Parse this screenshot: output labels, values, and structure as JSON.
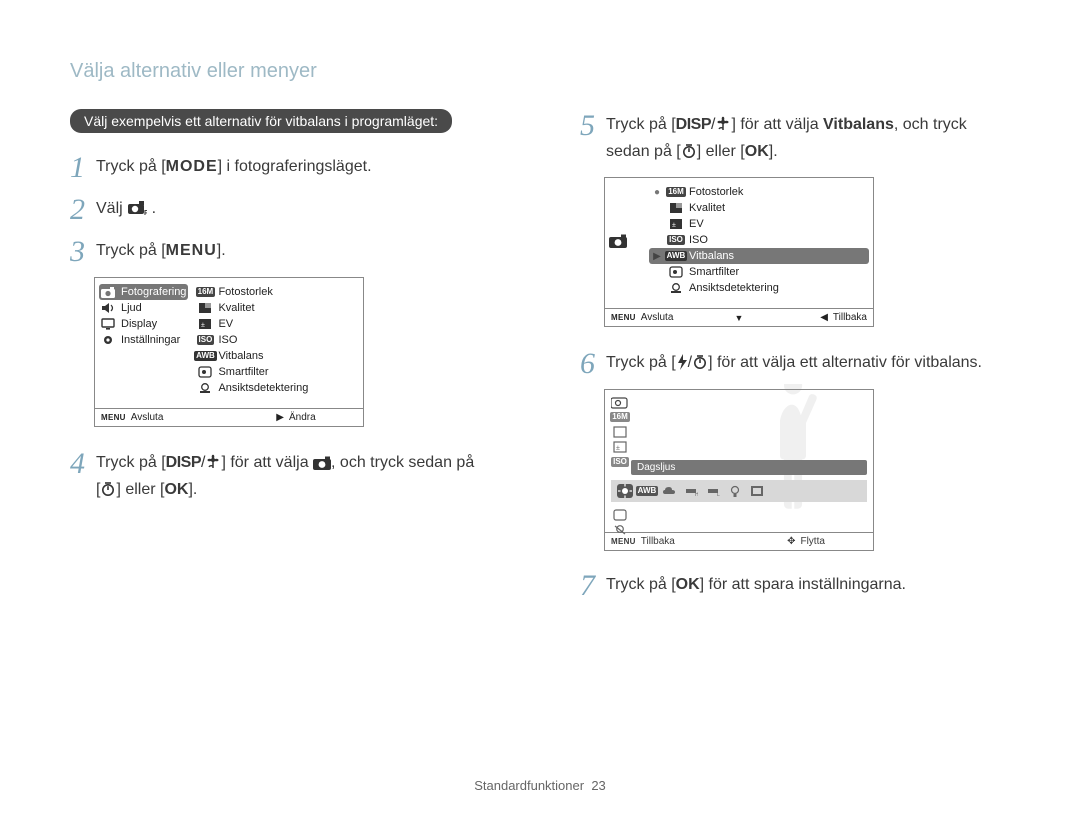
{
  "page_title": "Välja alternativ eller menyer",
  "pill": "Välj exempelvis ett alternativ för vitbalans i programläget:",
  "steps": {
    "1": {
      "pre": "Tryck på [",
      "btn": "MODE",
      "post": "] i fotograferingsläget."
    },
    "2": {
      "pre": "Välj ",
      "post": "."
    },
    "3": {
      "pre": "Tryck på [",
      "btn": "MENU",
      "post": "]."
    },
    "4": {
      "pre": "Tryck på [",
      "btn1": "DISP",
      "mid": "/",
      "post1": "] för att välja ",
      "rest1": ", och tryck sedan på",
      "line2a": "[",
      "line2b": "] eller [",
      "btn2": "OK",
      "line2c": "]."
    },
    "5": {
      "pre": "Tryck på [",
      "btn1": "DISP",
      "mid": "/",
      "post1": "] för att välja ",
      "bold": "Vitbalans",
      "post2": ", och tryck",
      "line2a": "sedan på [",
      "line2b": "] eller [",
      "btn2": "OK",
      "line2c": "]."
    },
    "6": {
      "pre": "Tryck på [",
      "mid": "/",
      "post": "] för att välja ett alternativ för vitbalans."
    },
    "7": {
      "pre": "Tryck på [",
      "btn": "OK",
      "post": "] för att spara inställningarna."
    }
  },
  "lcd1": {
    "left": [
      "Fotografering",
      "Ljud",
      "Display",
      "Inställningar"
    ],
    "right": [
      "Fotostorlek",
      "Kvalitet",
      "EV",
      "ISO",
      "Vitbalans",
      "Smartfilter",
      "Ansiktsdetektering"
    ],
    "bottom": {
      "left_lbl": "Avsluta",
      "right_lbl": "Ändra"
    }
  },
  "lcd2": {
    "right": [
      "Fotostorlek",
      "Kvalitet",
      "EV",
      "ISO",
      "Vitbalans",
      "Smartfilter",
      "Ansiktsdetektering"
    ],
    "selected_index": 4,
    "bottom": {
      "left_lbl": "Avsluta",
      "right_lbl": "Tillbaka"
    }
  },
  "lcd3": {
    "selected_label": "Dagsljus",
    "bottom": {
      "left_lbl": "Tillbaka",
      "right_lbl": "Flytta"
    }
  },
  "footer": {
    "section": "Standardfunktioner",
    "page": "23"
  },
  "icons": {
    "camera_p": "camera-p-icon",
    "camera": "camera-icon",
    "flower": "macro-flower-icon",
    "timer": "self-timer-icon",
    "flash": "flash-icon"
  }
}
